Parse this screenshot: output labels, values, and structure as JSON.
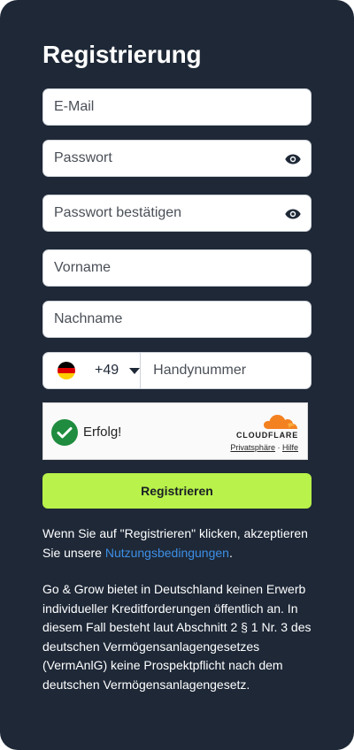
{
  "form": {
    "title": "Registrierung",
    "email_placeholder": "E-Mail",
    "password_placeholder": "Passwort",
    "confirm_password_placeholder": "Passwort bestätigen",
    "first_name_placeholder": "Vorname",
    "last_name_placeholder": "Nachname",
    "phone": {
      "country_code": "+49",
      "country_flag": "germany-flag",
      "placeholder": "Handynummer"
    },
    "submit_label": "Registrieren"
  },
  "captcha": {
    "status": "Erfolg!",
    "brand": "CLOUDFLARE",
    "privacy_link": "Privatsphäre",
    "separator": "·",
    "help_link": "Hilfe",
    "check_color": "#1f8c3f",
    "cloud_color": "#f48120"
  },
  "terms": {
    "text_before": "Wenn Sie auf \"Registrieren\" klicken, akzeptieren Sie unsere ",
    "link_text": "Nutzungsbedingungen",
    "text_after": "."
  },
  "legal_notice": "Go & Grow bietet in Deutschland keinen Erwerb individueller Kreditforderungen öffentlich an. In diesem Fall besteht laut Abschnitt 2 § 1 Nr. 3 des deutschen Vermögensanlagengesetzes (VermAnlG) keine Prospektpflicht nach dem deutschen Vermögensanlagengesetz.",
  "colors": {
    "panel_background": "#1e2837",
    "accent_button": "#b8f24a",
    "link": "#3d8fe6"
  }
}
